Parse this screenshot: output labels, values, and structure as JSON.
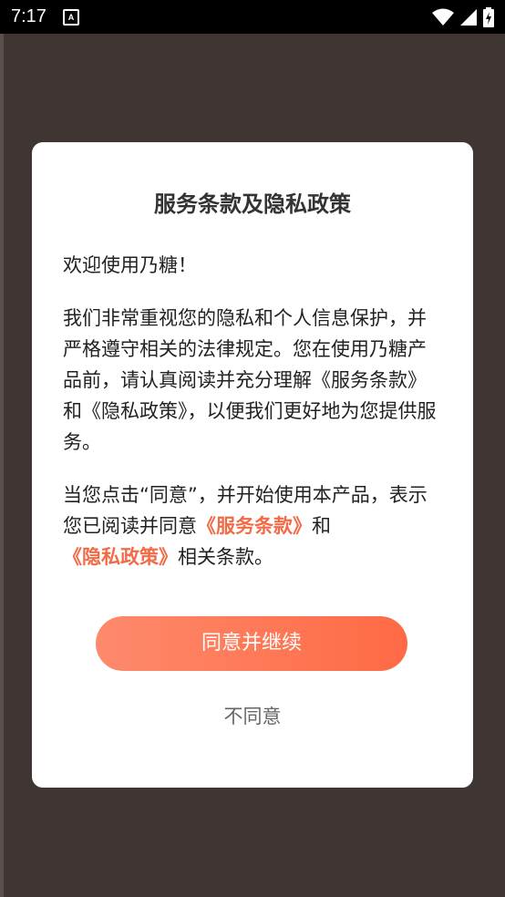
{
  "status_bar": {
    "time": "7:17",
    "notification_icon_label": "A"
  },
  "dialog": {
    "title": "服务条款及隐私政策",
    "greeting": "欢迎使用乃糖！",
    "paragraph2": " 我们非常重视您的隐私和个人信息保护，并严格遵守相关的法律规定。您在使用乃糖产品前，请认真阅读并充分理解《服务条款》和《隐私政策》，以便我们更好地为您提供服务。",
    "p3_part1": " 当您点击“同意”，并开始使用本产品，表示您已阅读并同意",
    "p3_link_terms": "《服务条款》",
    "p3_part2": "和",
    "p3_link_privacy": "《隐私政策》",
    "p3_part3": "相关条款。",
    "agree_label": "同意并继续",
    "disagree_label": "不同意"
  },
  "colors": {
    "accent": "#ff6a45",
    "link": "#f16b47",
    "backdrop": "#3f3634"
  }
}
